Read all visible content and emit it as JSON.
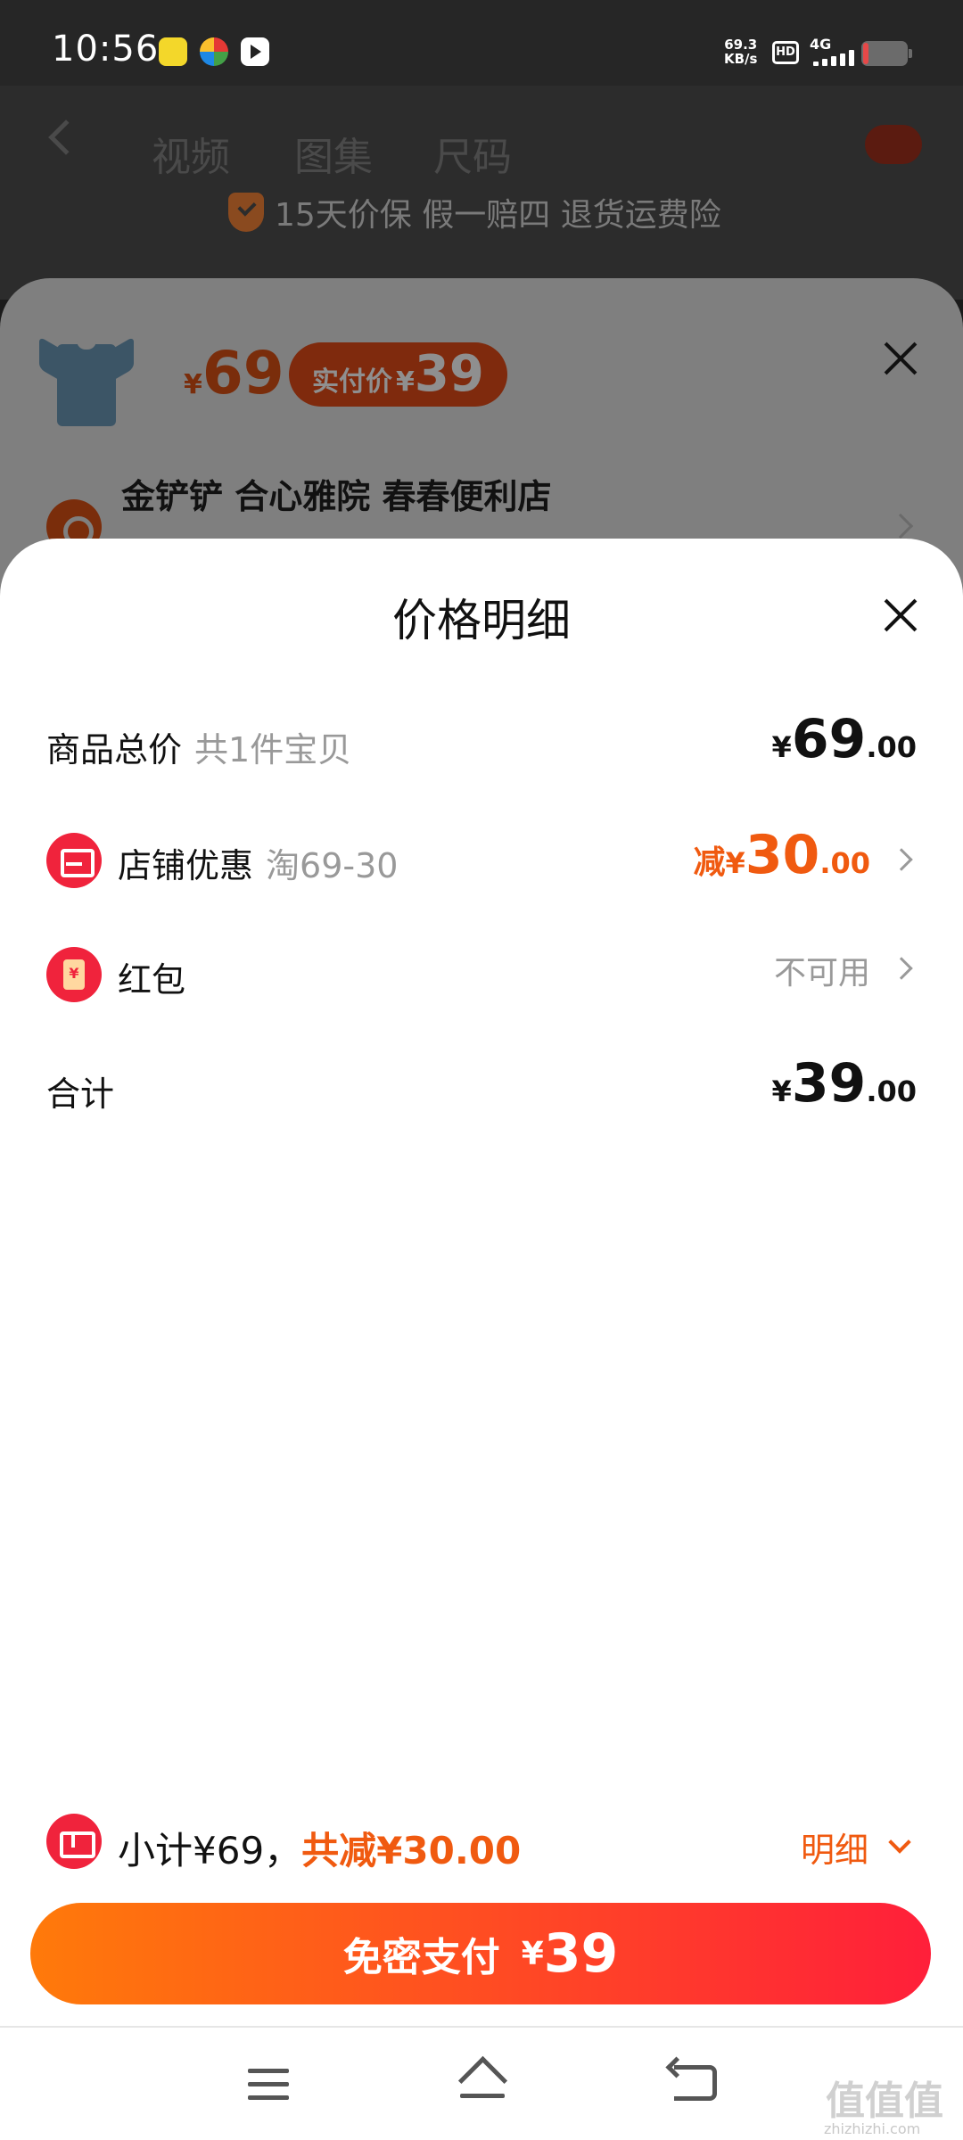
{
  "status_bar": {
    "time": "10:56",
    "net_speed_value": "69.3",
    "net_speed_unit": "KB/s",
    "hd_badge": "HD",
    "network": "4G"
  },
  "product_page": {
    "tabs": [
      "视频",
      "图集",
      "尺码"
    ],
    "guarantee": "15天价保 假一赔四 退货运费险"
  },
  "order_sheet": {
    "price_symbol": "¥",
    "price": "69",
    "paid_label": "实付价",
    "paid_symbol": "¥",
    "paid_price": "39",
    "address": "金铲铲 合心雅院 春春便利店"
  },
  "price_detail": {
    "title": "价格明细",
    "goods_total": {
      "label": "商品总价",
      "sub": "共1件宝贝",
      "symbol": "¥",
      "int": "69",
      "dec": ".00"
    },
    "shop_discount": {
      "label": "店铺优惠",
      "sub": "淘69-30",
      "prefix": "减",
      "symbol": "¥",
      "int": "30",
      "dec": ".00"
    },
    "red_packet": {
      "label": "红包",
      "status": "不可用"
    },
    "total": {
      "label": "合计",
      "symbol": "¥",
      "int": "39",
      "dec": ".00"
    }
  },
  "summary": {
    "subtotal_text": "小计¥69，",
    "discount_text": "共减¥30.00",
    "detail_label": "明细"
  },
  "pay_button": {
    "label": "免密支付",
    "symbol": "¥",
    "amount": "39"
  },
  "watermark": {
    "text": "值值值",
    "sub": "zhizhizhi.com"
  },
  "colors": {
    "accent_orange": "#f05a10",
    "accent_red": "#f0233c",
    "pay_gradient_start": "#ff7a0a",
    "pay_gradient_end": "#ff1f3a"
  }
}
